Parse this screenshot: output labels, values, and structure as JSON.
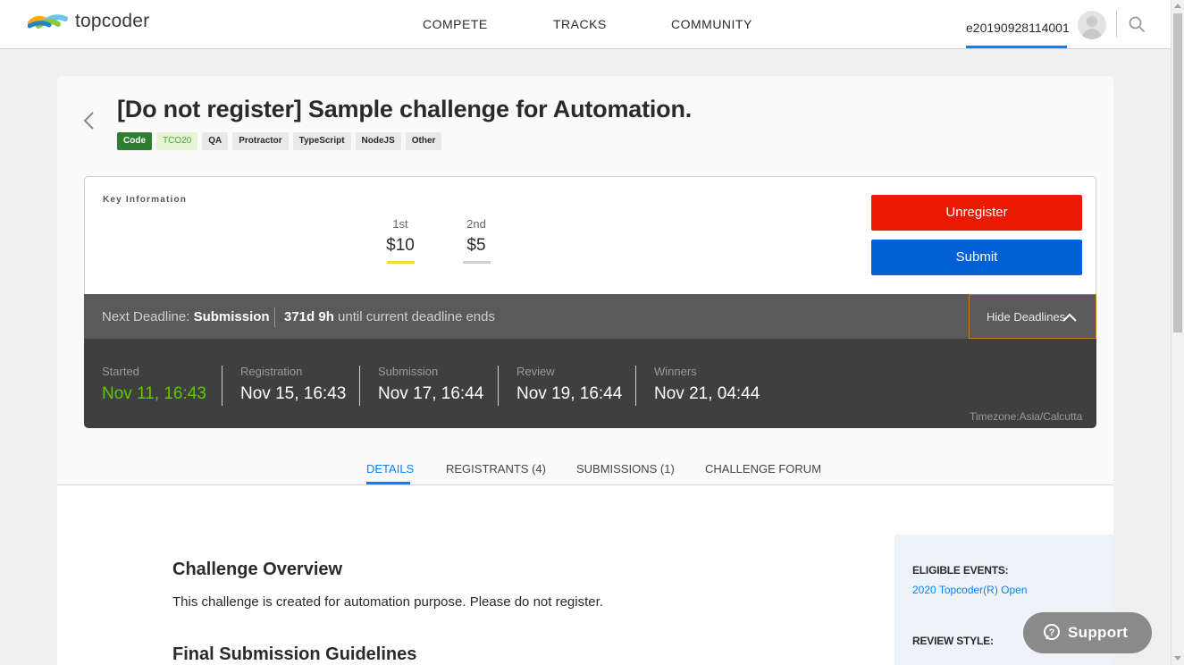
{
  "header": {
    "logo_text": "topcoder",
    "nav": [
      "COMPETE",
      "TRACKS",
      "COMMUNITY"
    ],
    "username": "e20190928114001",
    "icons": [
      "topcoder-logo-icon",
      "avatar-icon",
      "search-icon"
    ]
  },
  "challenge": {
    "title": "[Do not register] Sample challenge for Automation.",
    "tags": [
      "Code",
      "TCO20",
      "QA",
      "Protractor",
      "TypeScript",
      "NodeJS",
      "Other"
    ]
  },
  "key_info": {
    "label": "Key Information",
    "prizes": [
      {
        "place": "1st",
        "amount": "$10",
        "color": "#fdd835"
      },
      {
        "place": "2nd",
        "amount": "$5",
        "color": "#d0d0d0"
      }
    ],
    "unregister_label": "Unregister",
    "submit_label": "Submit"
  },
  "deadline": {
    "prefix": "Next Deadline:",
    "phase": "Submission",
    "remaining": "371d 9h",
    "suffix": "until current deadline ends",
    "hide_label": "Hide Deadlines",
    "stages": [
      {
        "name": "Started",
        "date": "Nov 11, 16:43"
      },
      {
        "name": "Registration",
        "date": "Nov 15, 16:43"
      },
      {
        "name": "Submission",
        "date": "Nov 17, 16:44"
      },
      {
        "name": "Review",
        "date": "Nov 19, 16:44"
      },
      {
        "name": "Winners",
        "date": "Nov 21, 04:44"
      }
    ],
    "timezone": "Timezone:Asia/Calcutta"
  },
  "tabs": [
    "DETAILS",
    "REGISTRANTS (4)",
    "SUBMISSIONS (1)",
    "CHALLENGE FORUM"
  ],
  "active_tab": "DETAILS",
  "content": {
    "overview_heading": "Challenge Overview",
    "overview_text": "This challenge is created for automation purpose. Please do not register.",
    "final_heading": "Final Submission Guidelines"
  },
  "sidebar": {
    "eligible_heading": "ELIGIBLE EVENTS:",
    "eligible_link": "2020 Topcoder(R) Open",
    "review_heading": "REVIEW STYLE:"
  },
  "support": {
    "label": "Support"
  },
  "colors": {
    "accent": "#0681ff",
    "unregister": "#e91a00",
    "submit": "#0160d5",
    "started_green": "#60c700"
  }
}
